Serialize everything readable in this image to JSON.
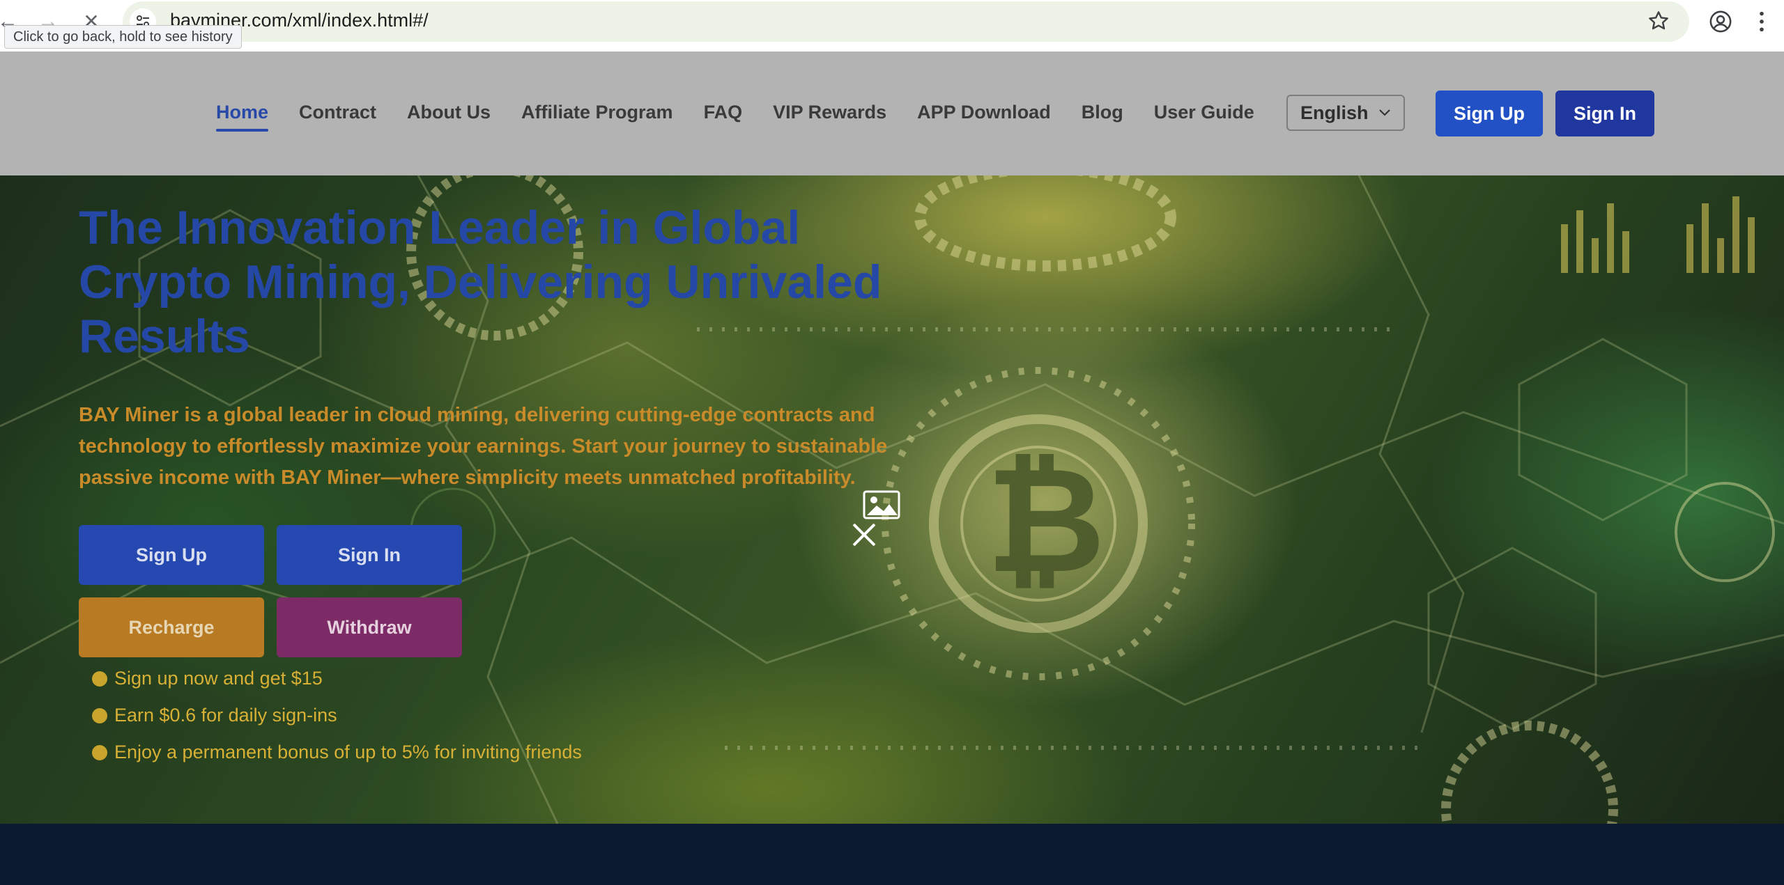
{
  "browser": {
    "url": "bayminer.com/xml/index.html#/",
    "tooltip": "Click to go back, hold to see history"
  },
  "header": {
    "nav": [
      {
        "label": "Home",
        "active": true
      },
      {
        "label": "Contract"
      },
      {
        "label": "About Us"
      },
      {
        "label": "Affiliate Program"
      },
      {
        "label": "FAQ"
      },
      {
        "label": "VIP Rewards"
      },
      {
        "label": "APP Download"
      },
      {
        "label": "Blog"
      },
      {
        "label": "User Guide"
      }
    ],
    "language": "English",
    "sign_up": "Sign Up",
    "sign_in": "Sign In"
  },
  "hero": {
    "title": "The Innovation Leader in Global Crypto Mining, Delivering Unrivaled Results",
    "description": "BAY Miner is a global leader in cloud mining, delivering cutting-edge contracts and technology to effortlessly maximize your earnings. Start your journey to sustainable passive income with BAY Miner—where simplicity meets unmatched profitability.",
    "buttons": {
      "sign_up": "Sign Up",
      "sign_in": "Sign In",
      "recharge": "Recharge",
      "withdraw": "Withdraw"
    },
    "perks": [
      "Sign up now and get $15",
      "Earn $0.6 for daily sign-ins",
      "Enjoy a permanent bonus of up to 5% for inviting friends"
    ]
  },
  "colors": {
    "primary_blue": "#2549b0",
    "accent_orange": "#c98a2a",
    "withdraw_purple": "#7d2b66",
    "header_gray": "#b3b3b3"
  }
}
